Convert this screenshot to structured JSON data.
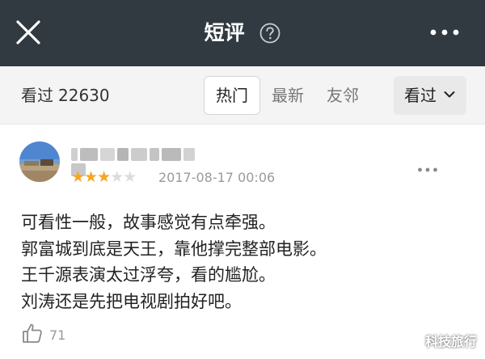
{
  "header": {
    "title": "短评",
    "close_icon": "close-icon",
    "help_icon": "question-circle-icon",
    "more_icon": "more-horizontal-icon",
    "background": "#303a40"
  },
  "filter_bar": {
    "watched_label": "看过",
    "watched_count": "22630",
    "tabs": [
      {
        "label": "热门",
        "active": true
      },
      {
        "label": "最新",
        "active": false
      },
      {
        "label": "友邻",
        "active": false
      }
    ],
    "dropdown_label": "看过"
  },
  "comment": {
    "rating": 3,
    "rating_max": 5,
    "star_color": "#f5a623",
    "date": "2017-08-17 00:06",
    "lines": [
      "可看性一般，故事感觉有点牵强。",
      "郭富城到底是天王，靠他撑完整部电影。",
      "王千源表演太过浮夸，看的尴尬。",
      "刘涛还是先把电视剧拍好吧。"
    ],
    "like_count": "71"
  },
  "watermark": "科技旅行"
}
